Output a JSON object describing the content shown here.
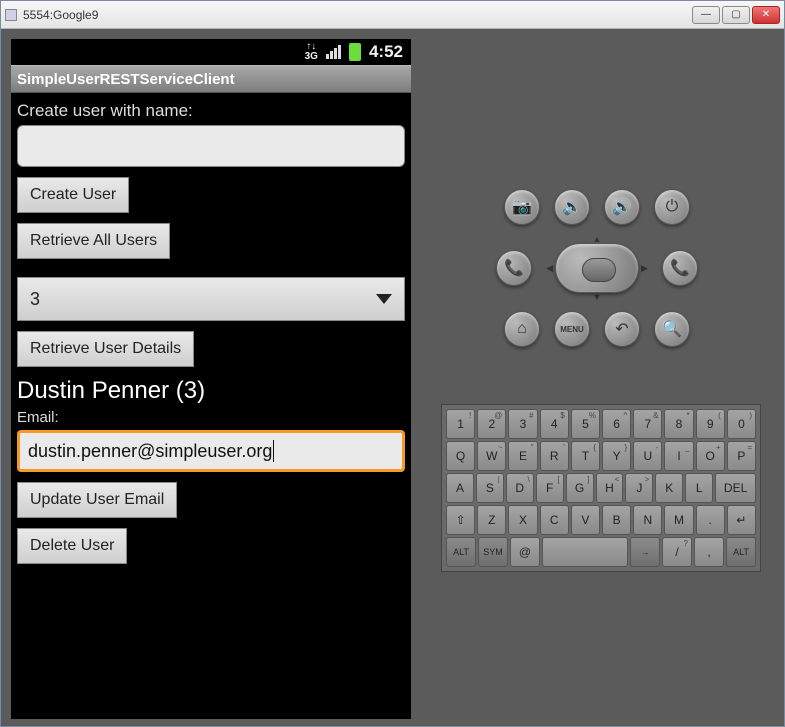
{
  "window": {
    "title": "5554:Google9"
  },
  "statusbar": {
    "time": "4:52"
  },
  "app": {
    "title": "SimpleUserRESTServiceClient",
    "create_label": "Create user with name:",
    "name_value": "",
    "create_btn": "Create User",
    "retrieve_all_btn": "Retrieve All Users",
    "dropdown_value": "3",
    "retrieve_details_btn": "Retrieve User Details",
    "user_display": "Dustin Penner (3)",
    "email_label": "Email:",
    "email_value": "dustin.penner@simpleuser.org",
    "update_btn": "Update User Email",
    "delete_btn": "Delete User"
  },
  "hw_buttons": {
    "camera": "📷",
    "vol_down": "🔈",
    "vol_up": "🔊",
    "power": "⏻",
    "call": "📞",
    "end": "📞",
    "home": "⌂",
    "menu": "MENU",
    "back": "↶",
    "search": "🔍"
  },
  "keyboard": {
    "row1": [
      {
        "m": "1",
        "s": "!"
      },
      {
        "m": "2",
        "s": "@"
      },
      {
        "m": "3",
        "s": "#"
      },
      {
        "m": "4",
        "s": "$"
      },
      {
        "m": "5",
        "s": "%"
      },
      {
        "m": "6",
        "s": "^"
      },
      {
        "m": "7",
        "s": "&"
      },
      {
        "m": "8",
        "s": "*"
      },
      {
        "m": "9",
        "s": "("
      },
      {
        "m": "0",
        "s": ")"
      }
    ],
    "row2": [
      {
        "m": "Q"
      },
      {
        "m": "W",
        "s": "~"
      },
      {
        "m": "E",
        "s": "\""
      },
      {
        "m": "R",
        "s": "'"
      },
      {
        "m": "T",
        "s": "{"
      },
      {
        "m": "Y",
        "s": "}"
      },
      {
        "m": "U",
        "s": "-"
      },
      {
        "m": "I",
        "s": "_"
      },
      {
        "m": "O",
        "s": "+"
      },
      {
        "m": "P",
        "s": "="
      }
    ],
    "row3": [
      {
        "m": "A"
      },
      {
        "m": "S",
        "s": "|"
      },
      {
        "m": "D",
        "s": "\\"
      },
      {
        "m": "F",
        "s": "["
      },
      {
        "m": "G",
        "s": "]"
      },
      {
        "m": "H",
        "s": "<"
      },
      {
        "m": "J",
        "s": ">"
      },
      {
        "m": "K",
        ";": ""
      },
      {
        "m": "L",
        ":": ""
      },
      {
        "m": "DEL",
        "del": true
      }
    ],
    "row4": [
      {
        "m": "⇧"
      },
      {
        "m": "Z"
      },
      {
        "m": "X"
      },
      {
        "m": "C"
      },
      {
        "m": "V"
      },
      {
        "m": "B"
      },
      {
        "m": "N"
      },
      {
        "m": "M"
      },
      {
        "m": "."
      },
      {
        "m": "↵"
      }
    ],
    "row5": [
      {
        "m": "ALT",
        "alt": true
      },
      {
        "m": "SYM",
        "alt": true
      },
      {
        "m": "@"
      },
      {
        "m": " ",
        "space": true
      },
      {
        "m": "→",
        "alt": true
      },
      {
        "m": "/",
        "s": "?"
      },
      {
        "m": ",",
        "s": ""
      },
      {
        "m": "ALT",
        "alt": true
      }
    ]
  }
}
